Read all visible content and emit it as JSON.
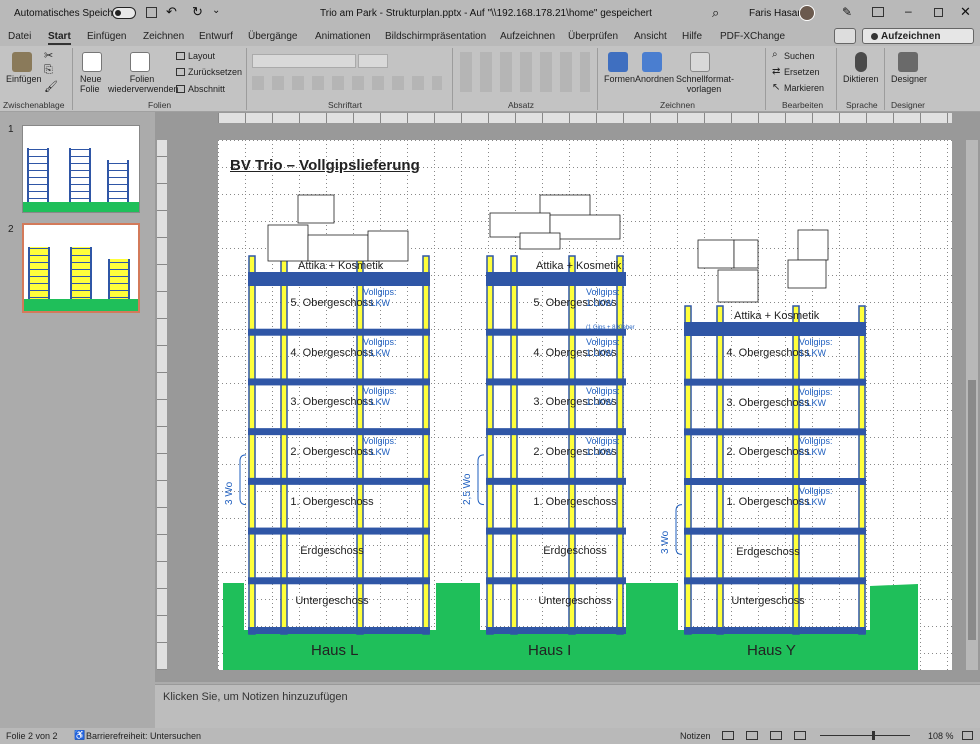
{
  "title_bar": {
    "autosave_label": "Automatisches Speichern",
    "document_title": "Trio am Park - Strukturplan.pptx  -  Auf \"\\\\192.168.178.21\\home\" gespeichert",
    "user_name": "Faris Hasan"
  },
  "menu": {
    "tabs": [
      "Datei",
      "Start",
      "Einfügen",
      "Zeichnen",
      "Entwurf",
      "Übergänge",
      "Animationen",
      "Bildschirmpräsentation",
      "Aufzeichnen",
      "Überprüfen",
      "Ansicht",
      "Hilfe",
      "PDF-XChange"
    ],
    "active_tab": "Start",
    "record_button": "Aufzeichnen"
  },
  "ribbon": {
    "clipboard": {
      "paste": "Einfügen",
      "group": "Zwischenablage"
    },
    "slides": {
      "new_slide": "Neue Folie",
      "reuse": "Folien wiederverwenden",
      "layout": "Layout",
      "reset": "Zurücksetzen",
      "section": "Abschnitt",
      "group": "Folien"
    },
    "font": {
      "group": "Schriftart"
    },
    "paragraph": {
      "group": "Absatz"
    },
    "drawing": {
      "shapes": "Formen",
      "arrange": "Anordnen",
      "quick_styles": "Schnellformat-vorlagen",
      "group": "Zeichnen"
    },
    "editing": {
      "find": "Suchen",
      "replace": "Ersetzen",
      "select": "Markieren",
      "group": "Bearbeiten"
    },
    "voice": {
      "dictate": "Diktieren",
      "group": "Sprache"
    },
    "designer": {
      "label": "Designer",
      "group": "Designer"
    }
  },
  "thumbnails": [
    {
      "number": "1",
      "selected": false
    },
    {
      "number": "2",
      "selected": true
    }
  ],
  "slide": {
    "title": "BV Trio – Vollgipslieferung",
    "houses": [
      {
        "name": "Haus L",
        "top_label": "Attika + Kosmetik",
        "floors": [
          "5. Obergeschoss",
          "4. Obergeschoss",
          "3. Obergeschoss",
          "2. Obergeschoss",
          "1. Obergeschoss",
          "Erdgeschoss",
          "Untergeschoss"
        ],
        "deliveries": [
          "Vollgips: 1 LKW",
          "Vollgips: 1 LKW",
          "Vollgips: 1 LKW",
          "Vollgips: 1 LKW",
          "",
          "",
          ""
        ],
        "wo_label": "3 Wo"
      },
      {
        "name": "Haus I",
        "top_label": "Attika + Kosmetik",
        "floors": [
          "5. Obergeschoss",
          "4. Obergeschoss",
          "3. Obergeschoss",
          "2. Obergeschoss",
          "1. Obergeschoss",
          "Erdgeschoss",
          "Untergeschoss"
        ],
        "deliveries": [
          "Vollgips: 1 LKW",
          "Vollgips: 1 LKW",
          "Vollgips: 1 LKW",
          "Vollgips: 1 LKW",
          "",
          "",
          ""
        ],
        "extra_note": "(1 Gips + 8 Kleber",
        "wo_label": "2,5 Wo"
      },
      {
        "name": "Haus Y",
        "top_label": "Attika + Kosmetik",
        "floors": [
          "4. Obergeschoss",
          "3. Obergeschoss",
          "2. Obergeschoss",
          "1. Obergeschoss",
          "Erdgeschoss",
          "Untergeschoss"
        ],
        "deliveries": [
          "Vollgips: 1 LKW",
          "Vollgips: 2 LKW",
          "Vollgips: 2 LKW",
          "Vollgips: 2 LKW",
          "",
          ""
        ],
        "wo_label": "3 Wo"
      }
    ]
  },
  "notes_placeholder": "Klicken Sie, um Notizen hinzuzufügen",
  "status": {
    "slide_info": "Folie 2 von 2",
    "accessibility": "Barrierefreiheit: Untersuchen",
    "notes": "Notizen",
    "zoom": "108 %"
  },
  "colors": {
    "beam": "#2f56a6",
    "column_fill": "#ffff3b",
    "ground": "#1fbf5a",
    "label_blue": "#1f5fbf"
  }
}
